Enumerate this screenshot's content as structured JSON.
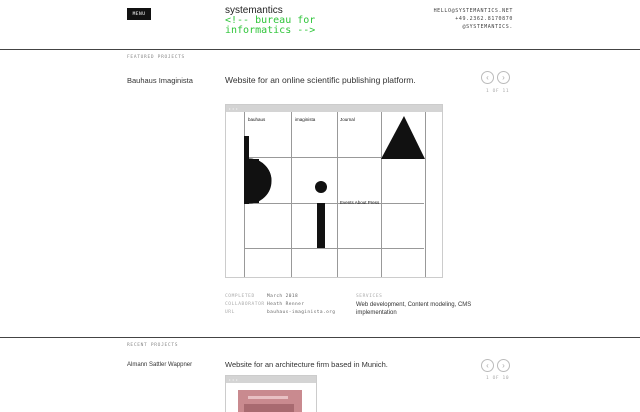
{
  "header": {
    "menu_label": "MENU",
    "brand_name": "systemantics",
    "brand_tagline_1": "<!-- bureau for",
    "brand_tagline_2": "informatics -->",
    "email": "HELLO@SYSTEMANTICS.NET",
    "phone": "+49.2362.8170870",
    "handle": "@SYSTEMANTICS."
  },
  "featured": {
    "section_label": "FEATURED PROJECTS",
    "project_name": "Bauhaus Imaginista",
    "title": "Website for an online scientific publishing platform.",
    "counter": "1 OF 11",
    "mock": {
      "dots": "• • •",
      "nav_1": "bauhaus",
      "nav_2": "imaginista",
      "nav_3": "Journal",
      "links": "Events  About  Press"
    },
    "meta": {
      "completed_label": "COMPLETED",
      "completed_value": "March 2018",
      "collaborator_label": "COLLABORATOR",
      "collaborator_value": "Heath Renner",
      "url_label": "URL",
      "url_value": "bauhaus-imaginista.org",
      "services_label": "SERVICES",
      "services_value": "Web development, Content modeling, CMS implementation"
    }
  },
  "recent": {
    "section_label": "RECENT PROJECTS",
    "project_name": "Almann Sattler Wappner",
    "title": "Website for an architecture firm based in Munich.",
    "counter": "1 OF 10",
    "mock": {
      "dots": "• • •"
    }
  },
  "icons": {
    "prev": "arrow-left-icon",
    "next": "arrow-right-icon"
  },
  "colors": {
    "tagline": "#2fc53a",
    "menu_bg": "#111111"
  }
}
